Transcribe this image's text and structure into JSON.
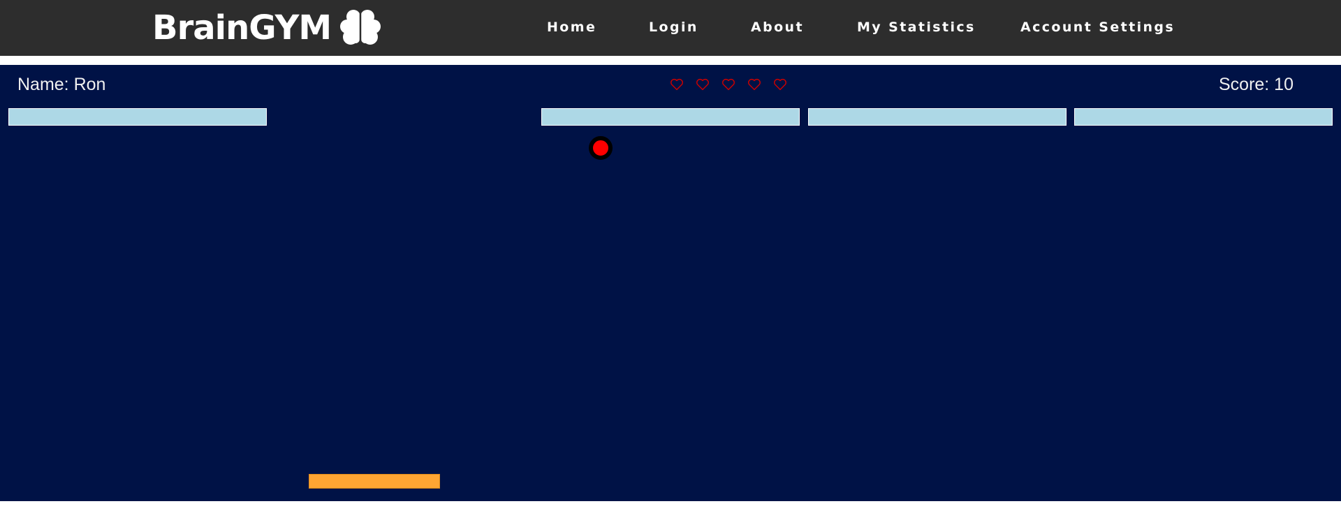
{
  "brand": {
    "name": "BrainGYM",
    "icon": "brain-icon"
  },
  "nav": {
    "items": [
      {
        "label": "Home"
      },
      {
        "label": "Login"
      },
      {
        "label": "About"
      },
      {
        "label": "My Statistics"
      },
      {
        "label": "Account Settings"
      }
    ]
  },
  "game": {
    "player_label": "Name: Ron",
    "score_label": "Score: 10",
    "lives": 5,
    "colors": {
      "background": "#001246",
      "brick": "#add8e6",
      "ball": "#ff0000",
      "paddle": "#ffa533",
      "heart": "#cc0000"
    },
    "bricks_visible": 4
  }
}
